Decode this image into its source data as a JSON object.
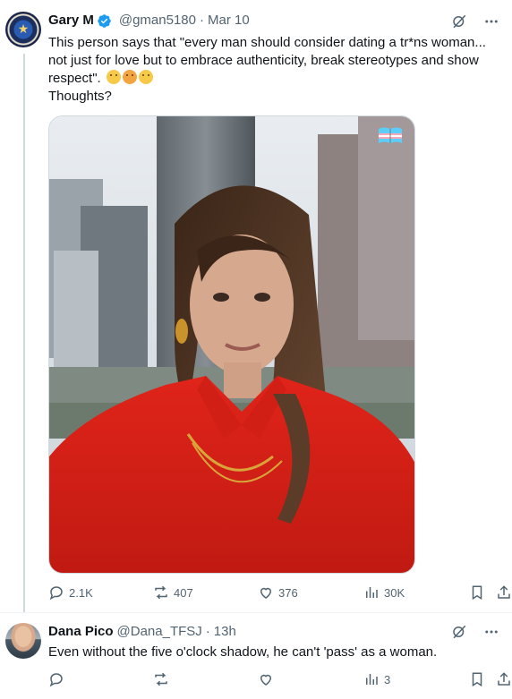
{
  "main_tweet": {
    "author_name": "Gary M",
    "handle": "@gman5180",
    "dot": "·",
    "date": "Mar 10",
    "text_line1": "This person says that \"every man should consider dating a tr*ns woman...",
    "text_line2": "not just for love but to embrace authenticity, break stereotypes and show",
    "text_line3": "respect\".",
    "text_line4": "Thoughts?",
    "emojis": [
      "thinking-face-emoji",
      "face-with-hand-over-mouth-emoji",
      "confused-face-emoji"
    ],
    "media_overlay_emoji": "transgender-flag-book-emoji",
    "stats": {
      "replies": "2.1K",
      "reposts": "407",
      "likes": "376",
      "views": "30K"
    }
  },
  "reply_tweet": {
    "author_name": "Dana Pico",
    "handle": "@Dana_TFSJ",
    "dot": "·",
    "date": "13h",
    "text": "Even without the five o'clock shadow, he can't 'pass' as a woman.",
    "stats": {
      "views": "3"
    }
  },
  "colors": {
    "text_primary": "#0f1419",
    "text_secondary": "#536471",
    "verified_blue": "#1d9bf0",
    "border": "#cfd9de"
  }
}
